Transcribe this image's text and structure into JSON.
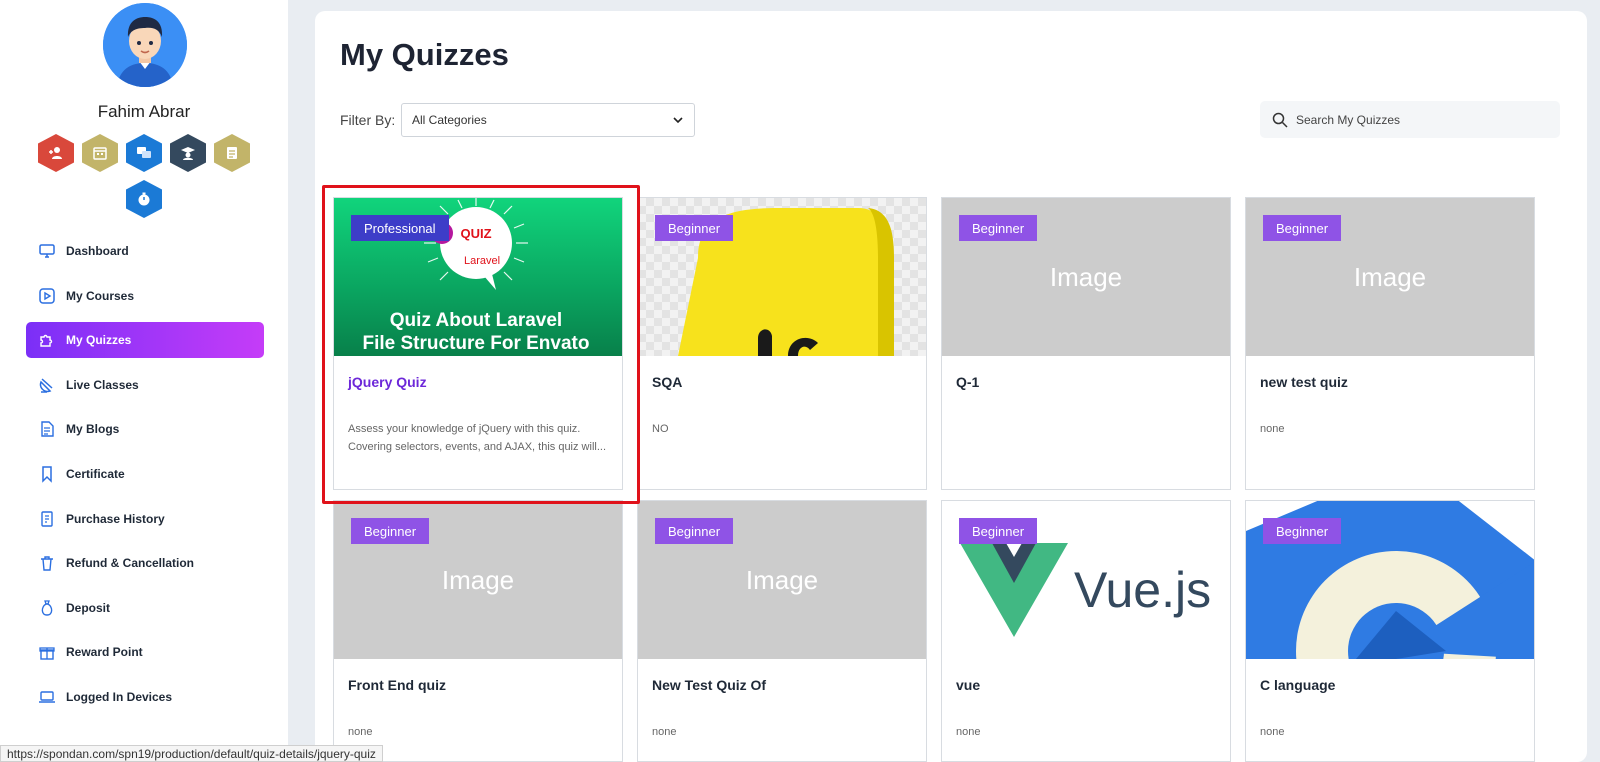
{
  "user": {
    "name": "Fahim Abrar"
  },
  "badges": [
    {
      "icon": "user-plus-icon",
      "color": "#d9483b"
    },
    {
      "icon": "calendar-icon",
      "color": "#c2b469"
    },
    {
      "icon": "chat-icon",
      "color": "#1b7ad6"
    },
    {
      "icon": "graduate-icon",
      "color": "#34495e"
    },
    {
      "icon": "document-icon",
      "color": "#c2b469"
    },
    {
      "icon": "timer-icon",
      "color": "#1b7ad6"
    }
  ],
  "nav": {
    "dashboard": "Dashboard",
    "my_courses": "My Courses",
    "my_quizzes": "My Quizzes",
    "live_classes": "Live Classes",
    "my_blogs": "My Blogs",
    "certificate": "Certificate",
    "purchase_history": "Purchase History",
    "refund": "Refund & Cancellation",
    "deposit": "Deposit",
    "reward_point": "Reward Point",
    "logged_in_devices": "Logged In Devices"
  },
  "main": {
    "title": "My Quizzes",
    "filter_label": "Filter By:",
    "filter_value": "All Categories",
    "search_placeholder": "Search My Quizzes"
  },
  "quiz_thumbnail": {
    "badge": "QUIZ",
    "brand": "Laravel",
    "line1": "Quiz About Laravel",
    "line2": "File Structure For Envato"
  },
  "vue_logo_text": "Vue.js",
  "cards": [
    {
      "level": "Professional",
      "title": "jQuery Quiz",
      "desc": "Assess your knowledge of jQuery with this quiz. Covering selectors, events, and AJAX, this quiz will..."
    },
    {
      "level": "Beginner",
      "title": "SQA",
      "desc": "NO"
    },
    {
      "level": "Beginner",
      "title": "Q-1",
      "desc": "",
      "thumb_text": "Image"
    },
    {
      "level": "Beginner",
      "title": "new test quiz",
      "desc": "none",
      "thumb_text": "Image"
    },
    {
      "level": "Beginner",
      "title": "Front End quiz",
      "desc": "none",
      "thumb_text": "Image"
    },
    {
      "level": "Beginner",
      "title": "New Test Quiz Of",
      "desc": "none",
      "thumb_text": "Image"
    },
    {
      "level": "Beginner",
      "title": "vue",
      "desc": "none"
    },
    {
      "level": "Beginner",
      "title": "C language",
      "desc": "none"
    }
  ],
  "status_url": "https://spondan.com/spn19/production/default/quiz-details/jquery-quiz",
  "colors": {
    "accent_start": "#7b2ff7",
    "accent_end": "#c53cf8",
    "level_badge": "#8f53e6",
    "pro_badge": "#3d3dc8",
    "highlight": "#e0121a"
  }
}
